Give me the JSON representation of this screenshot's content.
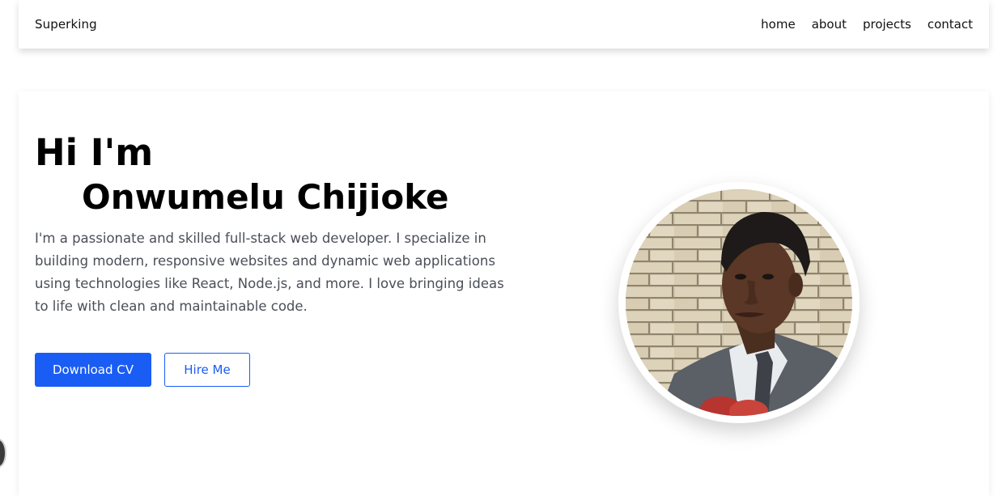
{
  "navbar": {
    "brand": "Superking",
    "links": [
      "home",
      "about",
      "projects",
      "contact"
    ]
  },
  "hero": {
    "greeting": "Hi I'm",
    "name": "Onwumelu Chijioke",
    "intro": "I'm a passionate and skilled full-stack web developer. I specialize in building modern, responsive websites and dynamic web applications using technologies like React, Node.js, and more. I love bringing ideas to life with clean and maintainable code.",
    "primary_button": "Download CV",
    "secondary_button": "Hire Me"
  },
  "colors": {
    "accent": "#1a5df5",
    "body_text": "#4a4f57",
    "heading": "#000000"
  }
}
